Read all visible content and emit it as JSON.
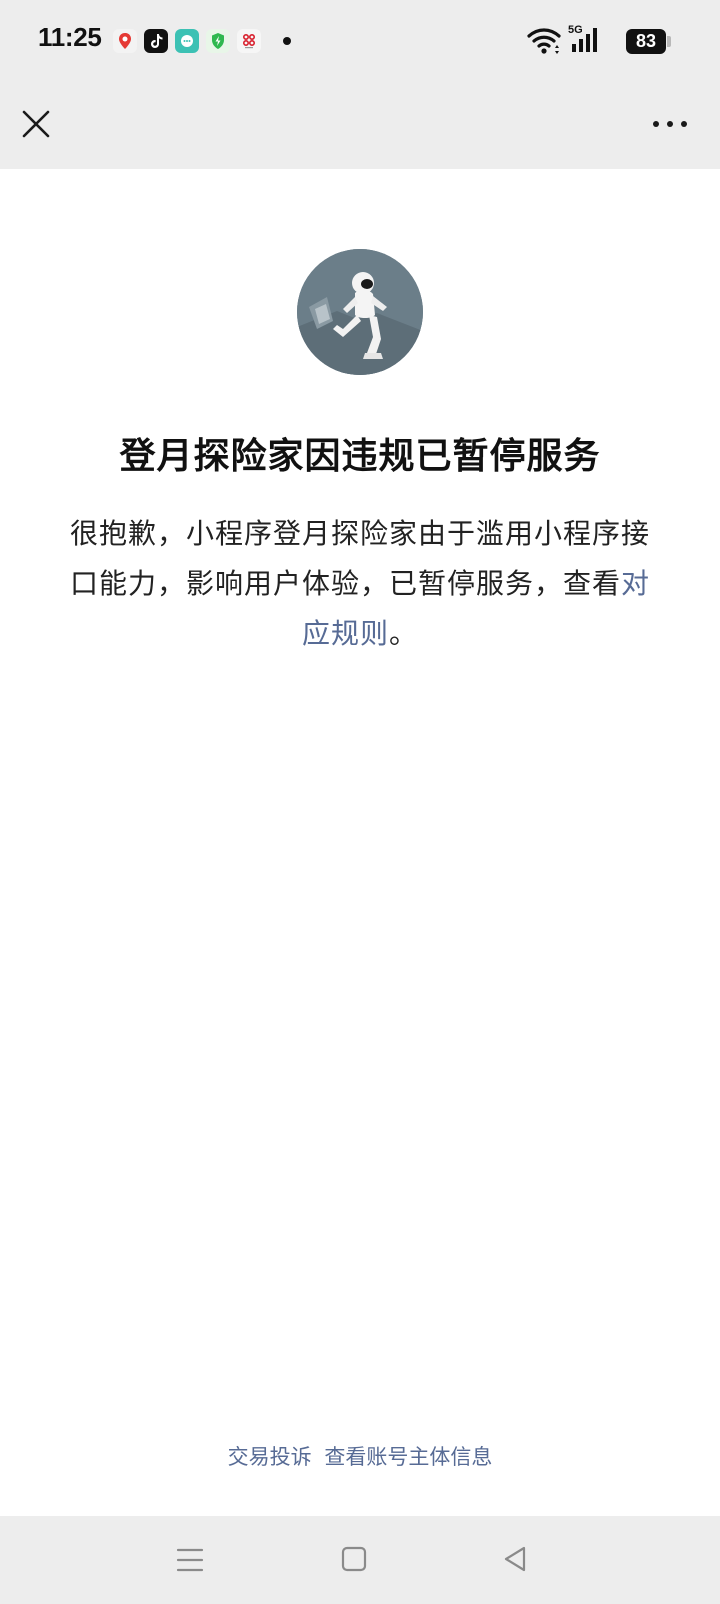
{
  "status_bar": {
    "time": "11:25",
    "network_label": "5G",
    "battery_level": "83",
    "notification_icons": [
      "maps-icon",
      "tiktok-icon",
      "chat-app-icon",
      "security-shield-icon",
      "china-unicom-icon"
    ]
  },
  "nav_bar": {
    "close_icon": "close-icon",
    "more_icon": "more-icon"
  },
  "notice": {
    "avatar_icon": "astronaut-avatar-icon",
    "title": "登月探险家因违规已暂停服务",
    "description_prefix": "很抱歉，小程序登月探险家由于滥用小程序接口能力，影响用户体验，已暂停服务，查看",
    "rules_link": "对应规则",
    "description_suffix": "。"
  },
  "footer": {
    "complaint_link": "交易投诉",
    "account_info_link": "查看账号主体信息"
  },
  "system_nav": {
    "menu_icon": "menu-icon",
    "home_icon": "home-icon",
    "back_icon": "back-icon"
  },
  "colors": {
    "background": "#ededed",
    "content_background": "#ffffff",
    "link": "#576b95",
    "title": "#111111"
  }
}
